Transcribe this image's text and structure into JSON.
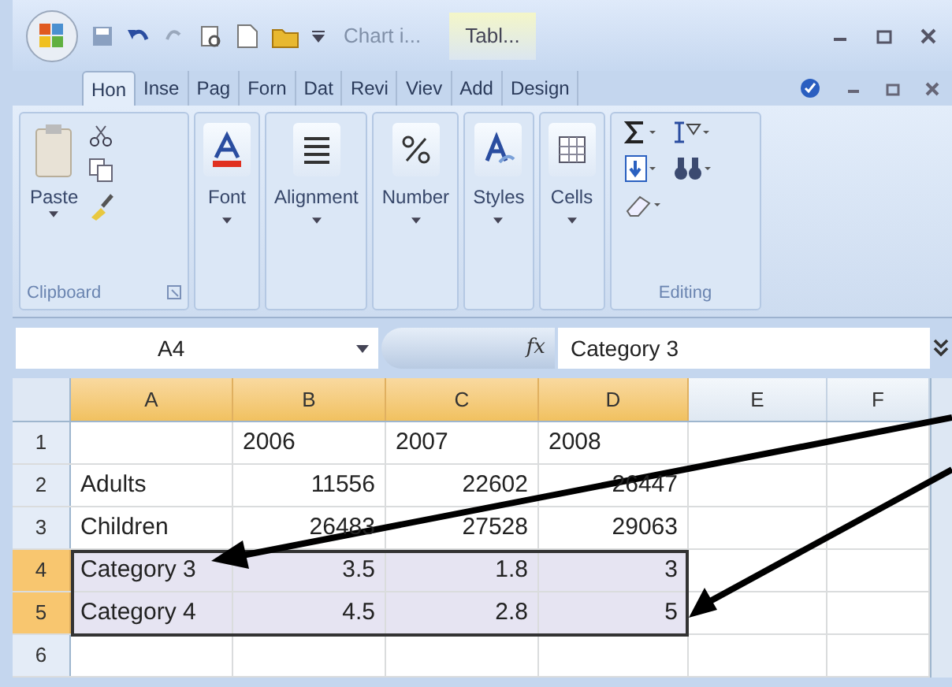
{
  "title_bar": {
    "title": "Chart i...",
    "context_tab": "Tabl..."
  },
  "tabs": [
    {
      "label": "Hon",
      "selected": true
    },
    {
      "label": "Inse",
      "selected": false
    },
    {
      "label": "Pag",
      "selected": false
    },
    {
      "label": "Forn",
      "selected": false
    },
    {
      "label": "Dat",
      "selected": false
    },
    {
      "label": "Revi",
      "selected": false
    },
    {
      "label": "Viev",
      "selected": false
    },
    {
      "label": "Add",
      "selected": false
    },
    {
      "label": "Design",
      "selected": false
    }
  ],
  "ribbon": {
    "clipboard": {
      "paste": "Paste",
      "label": "Clipboard"
    },
    "buttons": [
      {
        "label": "Font",
        "kind": "font"
      },
      {
        "label": "Alignment",
        "kind": "alignment"
      },
      {
        "label": "Number",
        "kind": "number"
      },
      {
        "label": "Styles",
        "kind": "styles"
      },
      {
        "label": "Cells",
        "kind": "cells"
      }
    ],
    "editing": {
      "label": "Editing"
    }
  },
  "formula_bar": {
    "name_box": "A4",
    "fx": "fx",
    "value": "Category 3"
  },
  "grid": {
    "columns": [
      {
        "label": "A",
        "selected": true
      },
      {
        "label": "B",
        "selected": true
      },
      {
        "label": "C",
        "selected": true
      },
      {
        "label": "D",
        "selected": true
      },
      {
        "label": "E",
        "selected": false
      },
      {
        "label": "F",
        "selected": false
      }
    ],
    "rows": [
      {
        "label": "1",
        "selected": false,
        "cells": [
          null,
          {
            "text": "2006",
            "kind": "text"
          },
          {
            "text": "2007",
            "kind": "text"
          },
          {
            "text": "2008",
            "kind": "text"
          }
        ]
      },
      {
        "label": "2",
        "selected": false,
        "cells": [
          {
            "text": "Adults",
            "kind": "text"
          },
          {
            "text": "11556",
            "kind": "number"
          },
          {
            "text": "22602",
            "kind": "number"
          },
          {
            "text": "26447",
            "kind": "number"
          }
        ]
      },
      {
        "label": "3",
        "selected": false,
        "cells": [
          {
            "text": "Children",
            "kind": "text"
          },
          {
            "text": "26483",
            "kind": "number"
          },
          {
            "text": "27528",
            "kind": "number"
          },
          {
            "text": "29063",
            "kind": "number"
          }
        ]
      },
      {
        "label": "4",
        "selected": true,
        "cells": [
          {
            "text": "Category 3",
            "kind": "text"
          },
          {
            "text": "3.5",
            "kind": "number"
          },
          {
            "text": "1.8",
            "kind": "number"
          },
          {
            "text": "3",
            "kind": "number"
          }
        ]
      },
      {
        "label": "5",
        "selected": true,
        "cells": [
          {
            "text": "Category 4",
            "kind": "text"
          },
          {
            "text": "4.5",
            "kind": "number"
          },
          {
            "text": "2.8",
            "kind": "number"
          },
          {
            "text": "5",
            "kind": "number"
          }
        ]
      },
      {
        "label": "6",
        "selected": false,
        "cells": []
      }
    ]
  }
}
